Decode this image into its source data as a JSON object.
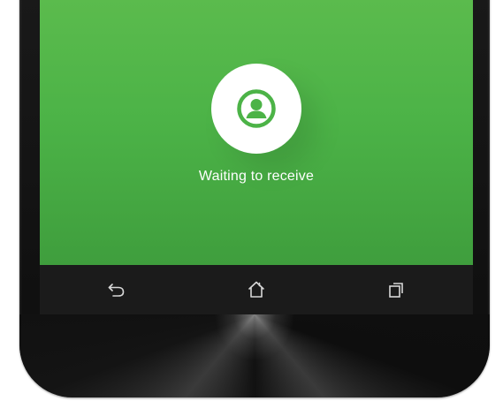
{
  "screen": {
    "status_text": "Waiting to receive",
    "background_color": "#4cb347",
    "avatar_icon": "person-circle-icon"
  },
  "navbar": {
    "back_icon": "back-icon",
    "home_icon": "home-icon",
    "recent_icon": "recent-apps-icon"
  }
}
